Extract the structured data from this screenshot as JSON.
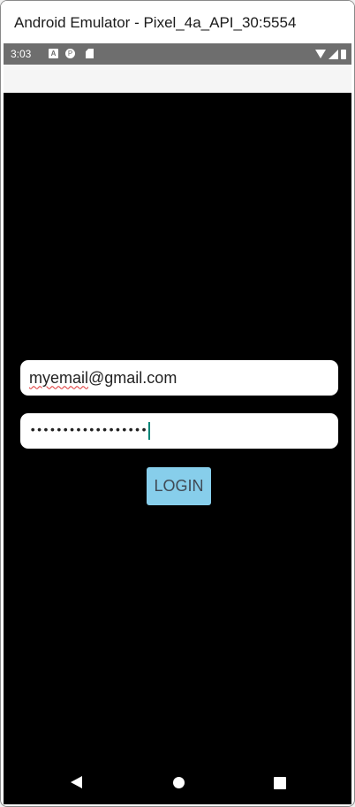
{
  "window": {
    "title": "Android Emulator - Pixel_4a_API_30:5554"
  },
  "status_bar": {
    "time": "3:03",
    "icons": [
      "notification-a-icon",
      "notification-p-icon",
      "sd-card-icon",
      "wifi-icon",
      "signal-icon",
      "battery-icon"
    ],
    "background": "#6e6e6e"
  },
  "login_form": {
    "email": {
      "misspelled_part": "myemail",
      "rest": "@gmail.com"
    },
    "password": {
      "masked_value": "••••••••••••••••••"
    },
    "login_button": {
      "label": "LOGIN",
      "color": "#87ceeb"
    }
  },
  "navigation_bar": {
    "icons": [
      "back-icon",
      "home-icon",
      "recents-icon"
    ]
  }
}
